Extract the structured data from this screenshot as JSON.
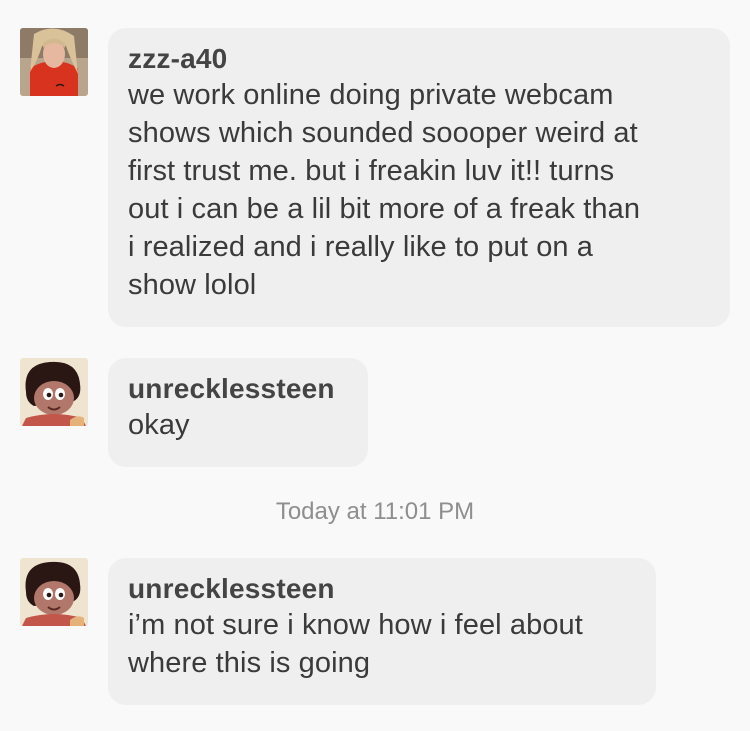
{
  "messages": [
    {
      "sender": "zzz-a40",
      "avatar_icon": "profile-photo-woman-red-shirt",
      "text": "we work online doing private webcam\nshows which sounded soooper weird at\nfirst trust me. but i freakin luv it!! turns\nout i can be a lil bit more of a freak than\ni realized and i really like to put on a\nshow lolol"
    },
    {
      "sender": "unrecklessteen",
      "avatar_icon": "cartoon-boy-avatar",
      "text": "okay"
    },
    {
      "sender": "unrecklessteen",
      "avatar_icon": "cartoon-boy-avatar",
      "text": "i’m not sure i know how i feel about\nwhere this is going"
    }
  ],
  "divider": {
    "timestamp": "Today at 11:01 PM"
  },
  "colors": {
    "background": "#f9f9f9",
    "bubble": "#efefef",
    "sender_text": "#444444",
    "body_text": "#3a3a3a",
    "timestamp_text": "#8e8e8e"
  }
}
